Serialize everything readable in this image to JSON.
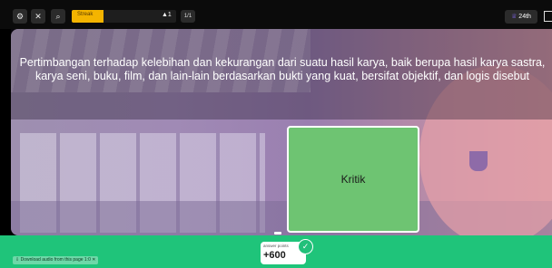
{
  "toolbar": {
    "settings_icon": "gear-icon",
    "powerups_icon": "shuffle-icon",
    "zoom_icon": "magnify-icon",
    "progress_label": "Streak",
    "progress_fraction": 0.3,
    "streak_value": "▲1",
    "question_counter": "1/1",
    "rank_label": "24th",
    "rank_icon": "medal-icon",
    "fullscreen_icon": "exit-icon"
  },
  "question": {
    "text": "Pertimbangan terhadap kelebihan dan kekurangan dari suatu hasil karya, baik berupa hasil karya sastra, karya seni, buku, film, dan lain-lain berdasarkan bukti yang kuat, bersifat objektif, dan logis disebut"
  },
  "answer": {
    "label": "Kritik",
    "color": "#6ec472"
  },
  "footer": {
    "download_label": "⇩ Download audio from this page 1:0 ✕",
    "points_label": "answer points",
    "points_value": "+600",
    "bar_color": "#1fc47a"
  }
}
